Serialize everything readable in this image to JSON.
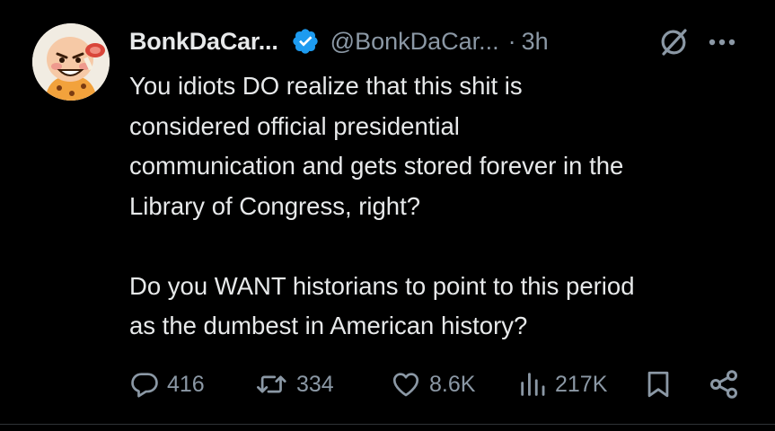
{
  "tweet": {
    "display_name": "BonkDaCar...",
    "handle": "@BonkDaCar...",
    "separator": "·",
    "time": "3h",
    "text": "You idiots DO realize that this shit is\nconsidered official presidential\ncommunication and gets stored forever in the\nLibrary of Congress, right?\n\nDo you WANT historians to point to this period\nas the dumbest in American history?",
    "verified_color": "#1d9bf0"
  },
  "actions": {
    "replies": "416",
    "reposts": "334",
    "likes": "8.6K",
    "views": "217K"
  },
  "icons": {
    "avatar": "cartoon-bonk-avatar",
    "verified": "verified-badge-icon",
    "grok": "grok-icon",
    "more": "more-icon",
    "reply": "reply-icon",
    "repost": "repost-icon",
    "like": "heart-icon",
    "views": "views-icon",
    "bookmark": "bookmark-icon",
    "share": "share-icon"
  },
  "colors": {
    "background": "#000000",
    "primary_text": "#e7e9ea",
    "secondary_text": "#8b98a5"
  }
}
